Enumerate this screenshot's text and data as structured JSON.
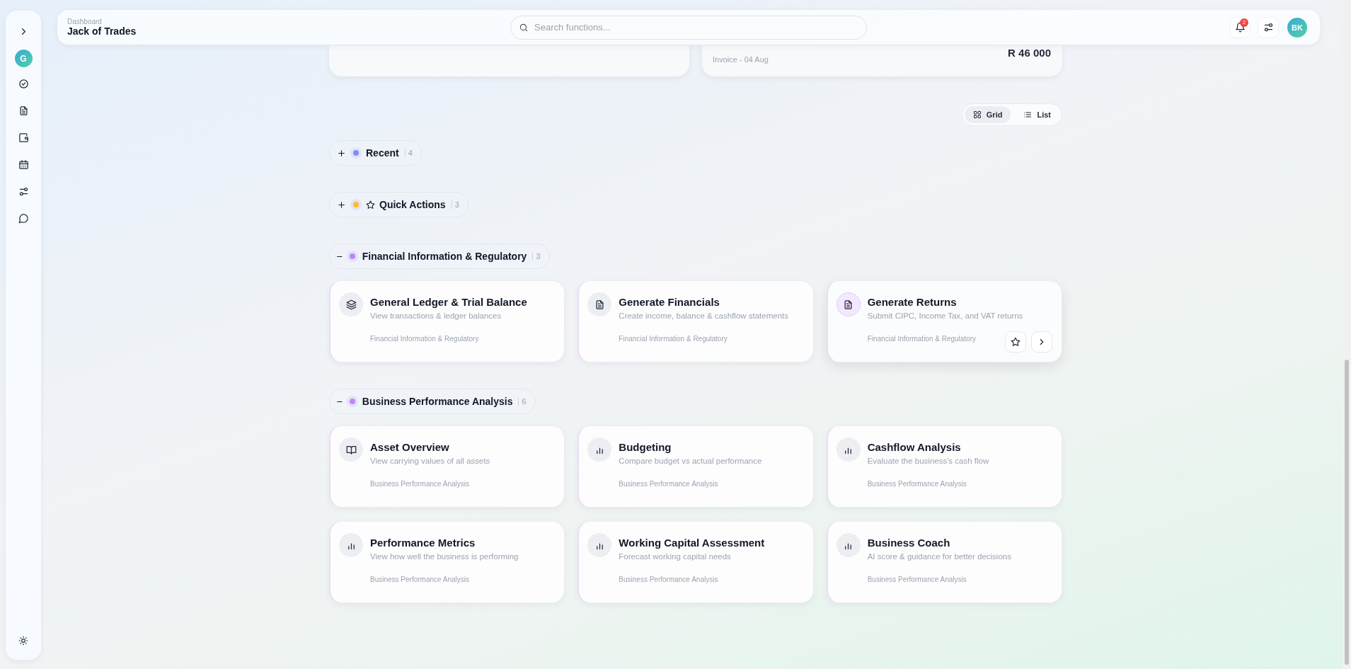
{
  "sidebar": {
    "avatar": "G"
  },
  "header": {
    "breadcrumb": "Dashboard",
    "title": "Jack of Trades",
    "search": {
      "placeholder": "Search functions..."
    },
    "notifications": "2",
    "avatar": "BK"
  },
  "documents": [
    {
      "subtitle": "Invoice - 04 Aug",
      "amount": "R 46 000"
    }
  ],
  "view_toggle": [
    {
      "label": "Grid",
      "selected": true
    },
    {
      "label": "List",
      "selected": false
    }
  ],
  "sections": [
    {
      "kind": "recent",
      "title": "Recent",
      "count": "4",
      "expanded": false,
      "color": "#818cf8"
    },
    {
      "kind": "favorites",
      "title": "Quick Actions",
      "count": "3",
      "expanded": false,
      "color": "#fbbf24"
    },
    {
      "kind": "category",
      "title": "Financial Information & Regulatory",
      "count": "3",
      "expanded": true,
      "color": "#c084fc",
      "cards": [
        {
          "title": "General Ledger & Trial Balance",
          "description": "View transactions & ledger balances",
          "category": "Financial Information & Regulatory",
          "hovered": false
        },
        {
          "title": "Generate Financials",
          "description": "Create income, balance & cashflow statements",
          "category": "Financial Information & Regulatory",
          "hovered": false
        },
        {
          "title": "Generate Returns",
          "description": "Submit CIPC, Income Tax, and VAT returns",
          "category": "Financial Information & Regulatory",
          "hovered": true
        }
      ]
    },
    {
      "kind": "category",
      "title": "Business Performance Analysis",
      "count": "6",
      "expanded": true,
      "color": "#c084fc",
      "cards": [
        {
          "title": "Asset Overview",
          "description": "View carrying values of all assets",
          "category": "Business Performance Analysis",
          "hovered": false
        },
        {
          "title": "Budgeting",
          "description": "Compare budget vs actual performance",
          "category": "Business Performance Analysis",
          "hovered": false
        },
        {
          "title": "Cashflow Analysis",
          "description": "Evaluate the business's cash flow",
          "category": "Business Performance Analysis",
          "hovered": false
        },
        {
          "title": "Performance Metrics",
          "description": "View how well the business is performing",
          "category": "Business Performance Analysis",
          "hovered": false
        },
        {
          "title": "Working Capital Assessment",
          "description": "Forecast working capital needs",
          "category": "Business Performance Analysis",
          "hovered": false
        },
        {
          "title": "Business Coach",
          "description": "AI score & guidance for better decisions",
          "category": "Business Performance Analysis",
          "hovered": false
        }
      ]
    }
  ]
}
